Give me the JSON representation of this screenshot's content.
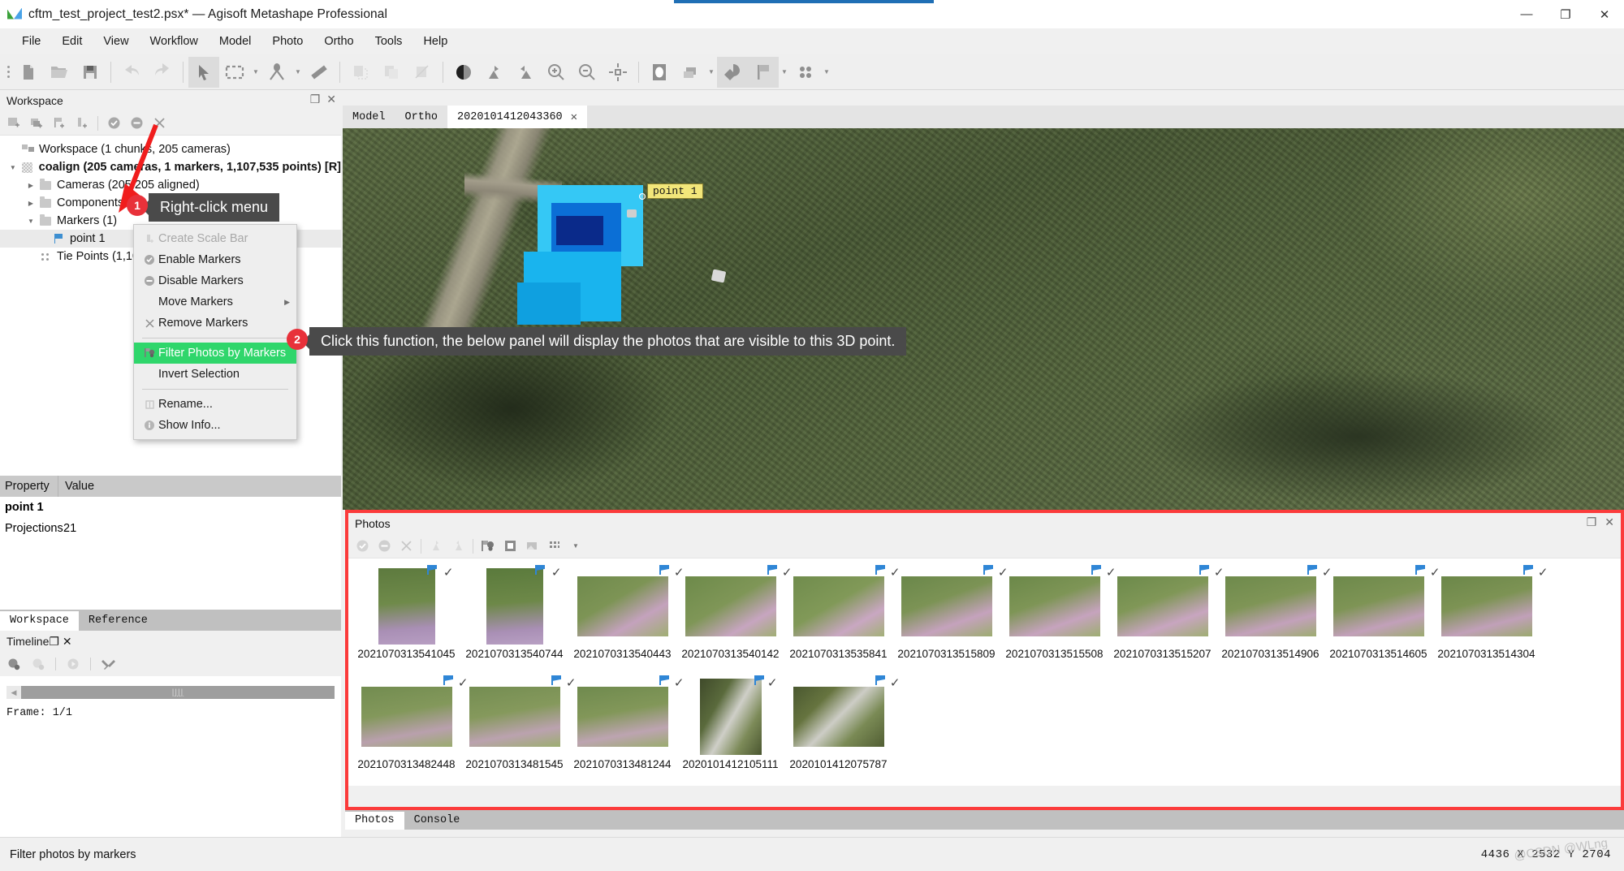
{
  "window": {
    "title": "cftm_test_project_test2.psx* — Agisoft Metashape Professional",
    "minimize": "—",
    "maximize": "❐",
    "close": "✕"
  },
  "menubar": [
    "File",
    "Edit",
    "View",
    "Workflow",
    "Model",
    "Photo",
    "Ortho",
    "Tools",
    "Help"
  ],
  "toolbar": {
    "groups": [
      [
        "new-document-icon",
        "open-folder-icon",
        "save-icon"
      ],
      [
        "undo-icon",
        "redo-icon"
      ],
      [
        "pointer-tool-icon",
        "rectangle-selection-icon",
        "measure-angle-icon",
        "ruler-icon"
      ],
      [
        "add-shape-icon",
        "duplicate-shape-icon",
        "cut-shape-icon"
      ],
      [
        "contrast-icon",
        "gradual-selection-icon",
        "reset-selection-icon",
        "zoom-in-icon",
        "zoom-out-icon",
        "reset-view-icon"
      ],
      [
        "point-cloud-icon",
        "layers-icon",
        "shaded-model-icon",
        "markers-visibility-icon",
        "tie-points-icon"
      ]
    ]
  },
  "workspace_panel": {
    "title": "Workspace",
    "tools": [
      "add-chunk-icon",
      "add-photos-icon",
      "add-markers-icon",
      "add-scalebar-icon",
      "enable-icon",
      "disable-icon",
      "remove-icon"
    ],
    "tree": [
      {
        "label": "Workspace (1 chunks, 205 cameras)",
        "icon": "workspace-icon",
        "indent": 0,
        "arrow": "",
        "bold": false
      },
      {
        "label": "coalign (205 cameras, 1 markers, 1,107,535 points) [R]",
        "icon": "chunk-icon",
        "indent": 1,
        "arrow": "▼",
        "bold": true
      },
      {
        "label": "Cameras (205/205 aligned)",
        "icon": "folder-icon",
        "indent": 2,
        "arrow": "▶",
        "bold": false
      },
      {
        "label": "Components (1)",
        "icon": "folder-icon",
        "indent": 2,
        "arrow": "▶",
        "bold": false
      },
      {
        "label": "Markers (1)",
        "icon": "folder-icon",
        "indent": 2,
        "arrow": "▼",
        "bold": false
      },
      {
        "label": "point 1",
        "icon": "marker-flag-icon",
        "indent": 3,
        "arrow": "",
        "bold": false,
        "selected": true
      },
      {
        "label": "Tie Points (1,107",
        "icon": "tie-points-icon",
        "indent": 2,
        "arrow": "",
        "bold": false
      }
    ]
  },
  "context_menu": {
    "items": [
      {
        "label": "Create Scale Bar",
        "icon": "scalebar-icon",
        "state": "disabled"
      },
      {
        "label": "Enable Markers",
        "icon": "enable-check-icon",
        "state": "normal"
      },
      {
        "label": "Disable Markers",
        "icon": "disable-minus-icon",
        "state": "normal"
      },
      {
        "label": "Move Markers",
        "icon": "",
        "state": "normal",
        "submenu": "▶"
      },
      {
        "label": "Remove Markers",
        "icon": "remove-x-icon",
        "state": "normal"
      },
      {
        "separator": true
      },
      {
        "label": "Filter Photos by Markers",
        "icon": "filter-photos-icon",
        "state": "highlighted"
      },
      {
        "label": "Invert Selection",
        "icon": "",
        "state": "normal"
      },
      {
        "separator": true
      },
      {
        "label": "Rename...",
        "icon": "rename-icon",
        "state": "normal"
      },
      {
        "label": "Show Info...",
        "icon": "info-icon",
        "state": "normal"
      }
    ]
  },
  "property_panel": {
    "columns": [
      "Property",
      "Value"
    ],
    "rows": [
      {
        "key": "point 1",
        "value": "",
        "bold": true
      },
      {
        "key": "Projections",
        "value": "21",
        "bold": false
      }
    ]
  },
  "dock_tabs": [
    {
      "label": "Workspace",
      "active": true
    },
    {
      "label": "Reference",
      "active": false
    }
  ],
  "timeline": {
    "title": "Timeline",
    "tools": [
      "add-keyframe-icon",
      "remove-keyframe-icon",
      "play-icon",
      "settings-icon"
    ],
    "frame_label": "Frame: 1/1"
  },
  "view_tabs": [
    {
      "label": "Model",
      "active": false,
      "closable": false
    },
    {
      "label": "Ortho",
      "active": false,
      "closable": false
    },
    {
      "label": "2020101412043360",
      "active": true,
      "closable": true,
      "close": "✕"
    }
  ],
  "viewport": {
    "marker_label": "point 1"
  },
  "photos_panel": {
    "title": "Photos",
    "tools": [
      "enable-icon",
      "disable-icon",
      "remove-icon",
      "rotate-left-icon",
      "rotate-right-icon",
      "filter-by-markers-icon",
      "reset-filter-icon",
      "thumbnail-icon",
      "grid-icon",
      "grid-dropdown-caret"
    ],
    "thumbnails": [
      {
        "name": "2021070313541045",
        "flag": true,
        "checked": true,
        "orientation": "portrait"
      },
      {
        "name": "2021070313540744",
        "flag": true,
        "checked": true,
        "orientation": "portrait"
      },
      {
        "name": "2021070313540443",
        "flag": true,
        "checked": true,
        "orientation": "landscape"
      },
      {
        "name": "2021070313540142",
        "flag": true,
        "checked": true,
        "orientation": "landscape"
      },
      {
        "name": "2021070313535841",
        "flag": true,
        "checked": true,
        "orientation": "landscape"
      },
      {
        "name": "2021070313515809",
        "flag": true,
        "checked": true,
        "orientation": "landscape"
      },
      {
        "name": "2021070313515508",
        "flag": true,
        "checked": true,
        "orientation": "landscape"
      },
      {
        "name": "2021070313515207",
        "flag": true,
        "checked": true,
        "orientation": "landscape"
      },
      {
        "name": "2021070313514906",
        "flag": true,
        "checked": true,
        "orientation": "landscape"
      },
      {
        "name": "2021070313514605",
        "flag": true,
        "checked": true,
        "orientation": "landscape"
      },
      {
        "name": "2021070313514304",
        "flag": true,
        "checked": true,
        "orientation": "landscape"
      },
      {
        "name": "2021070313482448",
        "flag": true,
        "checked": true,
        "orientation": "landscape"
      },
      {
        "name": "2021070313481545",
        "flag": true,
        "checked": true,
        "orientation": "landscape"
      },
      {
        "name": "2021070313481244",
        "flag": true,
        "checked": true,
        "orientation": "landscape"
      },
      {
        "name": "2020101412105111",
        "flag": true,
        "checked": true,
        "orientation": "portrait"
      },
      {
        "name": "2020101412075787",
        "flag": true,
        "checked": true,
        "orientation": "landscape"
      }
    ],
    "tabs": [
      {
        "label": "Photos",
        "active": true
      },
      {
        "label": "Console",
        "active": false
      }
    ]
  },
  "callouts": [
    {
      "number": "1",
      "text": "Right-click menu"
    },
    {
      "number": "2",
      "text": "Click this function, the below panel will display the photos that are visible to this 3D point."
    }
  ],
  "statusbar": {
    "message": "Filter photos by markers",
    "coords": "4436 X  2532 Y  2704",
    "watermark": "@CSDN @WLng"
  },
  "colors": {
    "highlight_green": "#2fd66b",
    "callout_bg": "#4a4a4a",
    "badge_red": "#e8313a",
    "panel_border_red": "#fb3b3b",
    "marker_yellow": "#f2e67a"
  }
}
